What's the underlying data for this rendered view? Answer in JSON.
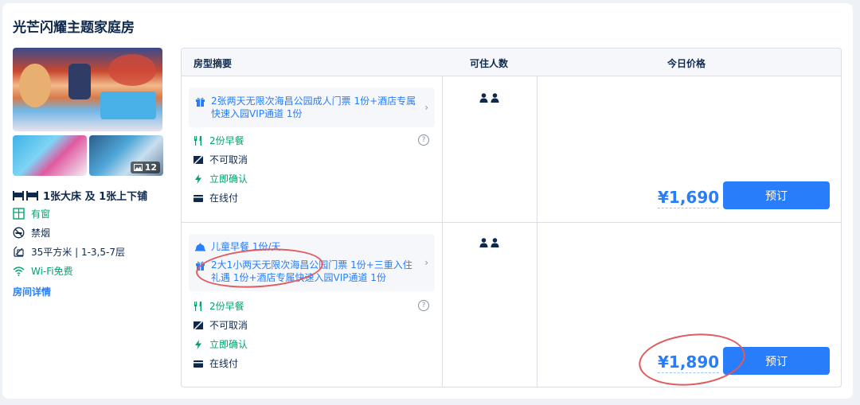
{
  "room": {
    "title": "光芒闪耀主题家庭房",
    "photo_count": "12",
    "bed": "1张大床 及 1张上下铺",
    "features": [
      {
        "icon": "window-icon",
        "text": "有窗"
      },
      {
        "icon": "no-smoking-icon",
        "text": "禁烟"
      },
      {
        "icon": "area-icon",
        "text": "35平方米 | 1-3,5-7层"
      },
      {
        "icon": "wifi-icon",
        "text": "Wi-Fi免费"
      }
    ],
    "details_link": "房间详情"
  },
  "table": {
    "headers": {
      "summary": "房型摘要",
      "guests": "可住人数",
      "price": "今日价格"
    },
    "rows": [
      {
        "packages": [
          "2张两天无限次海昌公园成人门票 1份+酒店专属快速入园VIP通道 1份"
        ],
        "breakfast": "2份早餐",
        "cancel": "不可取消",
        "confirm": "立即确认",
        "payment": "在线付",
        "price": "¥1,690",
        "book": "预订"
      },
      {
        "kids_breakfast": "儿童早餐 1份/天",
        "packages": [
          "2大1小两天无限次海昌公园门票 1份+三重入住礼遇 1份+酒店专属快速入园VIP通道 1份"
        ],
        "breakfast": "2份早餐",
        "cancel": "不可取消",
        "confirm": "立即确认",
        "payment": "在线付",
        "price": "¥1,890",
        "book": "预订"
      }
    ]
  },
  "colors": {
    "accent": "#287dfa",
    "green": "#00a56a",
    "annotation": "#e05a5e"
  }
}
